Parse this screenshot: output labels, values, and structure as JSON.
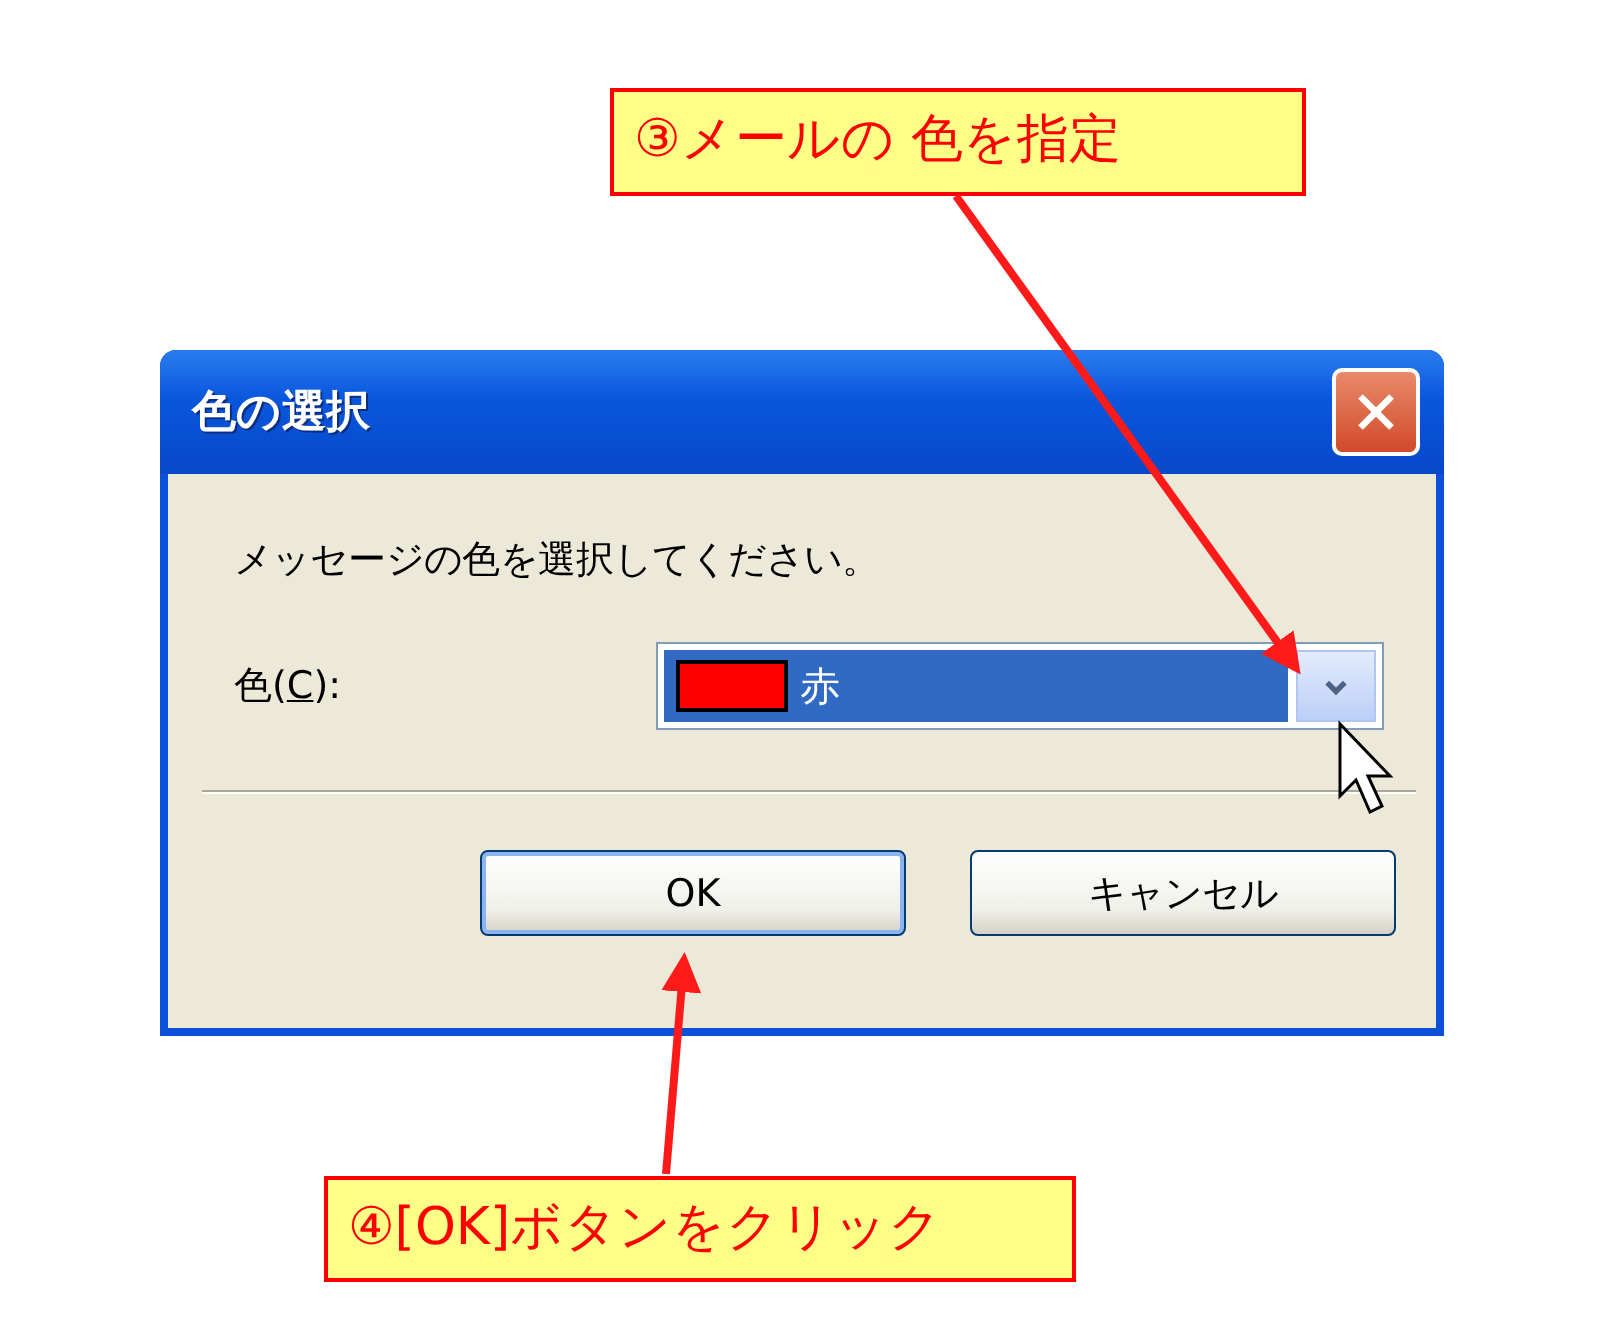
{
  "window": {
    "title": "色の選択"
  },
  "message": "メッセージの色を選択してください。",
  "color_field": {
    "label_before": "色(",
    "mnemonic": "C",
    "label_after": "):",
    "value": "赤",
    "color": "#ff0000",
    "focused": true
  },
  "buttons": [
    {
      "label": "OK",
      "default": true
    },
    {
      "label": "キャンセル",
      "default": false
    }
  ],
  "callouts": [
    {
      "text": "③メールの 色を指定"
    },
    {
      "text": "④[OK]ボタンをクリック"
    }
  ]
}
